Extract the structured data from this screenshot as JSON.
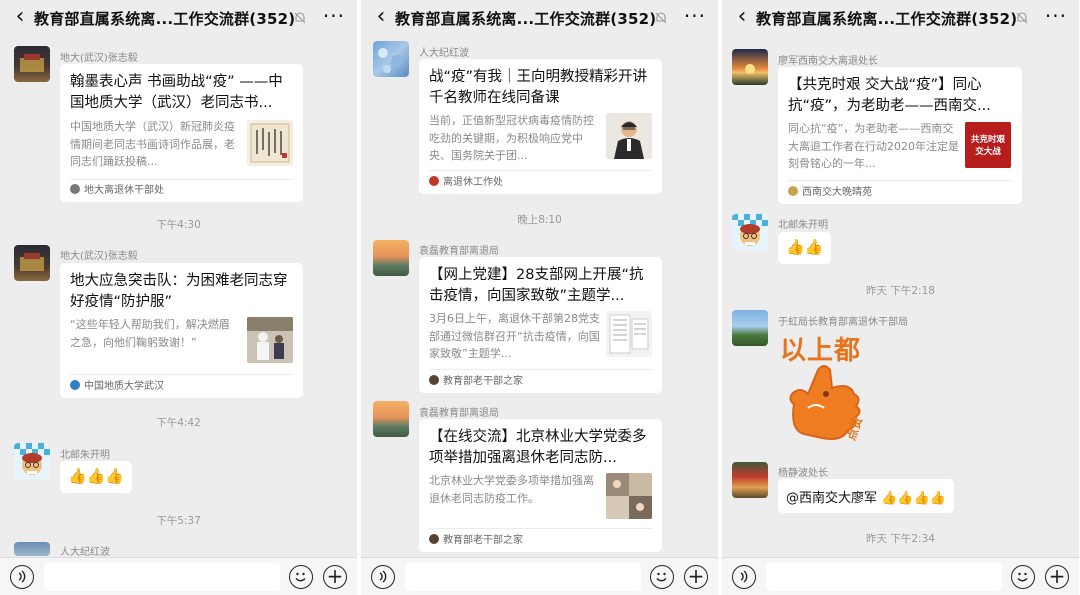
{
  "header": {
    "title": "教育部直属系统离...工作交流群(352)"
  },
  "panels": [
    {
      "messages": [
        {
          "sender": "地大(武汉)张志毅",
          "title": "翰墨表心声 书画助战“疫” ——中国地质大学（武汉）老同志书...",
          "desc": "中国地质大学（武汉）新冠肺炎疫情期间老同志书画诗词作品展，老同志们踊跃投稿...",
          "source": "地大离退休干部处"
        },
        {
          "time": "下午4:30"
        },
        {
          "sender": "地大(武汉)张志毅",
          "title": "地大应急突击队：为困难老同志穿好疫情“防护服”",
          "desc": "“这些年轻人帮助我们，解决燃眉之急，向他们鞠躬致谢！”",
          "source": "中国地质大学武汉"
        },
        {
          "time": "下午4:42"
        },
        {
          "sender": "北邮朱开明",
          "text": "👍👍👍"
        },
        {
          "time": "下午5:37"
        },
        {
          "sender": "人大纪红波"
        }
      ]
    },
    {
      "messages": [
        {
          "sender": "人大纪红波",
          "title": "战“疫”有我｜王向明教授精彩开讲千名教师在线同备课",
          "desc": "当前，正值新型冠状病毒疫情防控吃劲的关键期，为积极响应党中央、国务院关于团...",
          "source": "离退休工作处"
        },
        {
          "time": "晚上8:10"
        },
        {
          "sender": "袁磊教育部离退局",
          "title": "【网上党建】28支部网上开展“抗击疫情，向国家致敬”主题学...",
          "desc": "3月6日上午，离退休干部第28党支部通过微信群召开“抗击疫情，向国家致敬”主题学...",
          "source": "教育部老干部之家"
        },
        {
          "sender": "袁磊教育部离退局",
          "title": "【在线交流】北京林业大学党委多项举措加强离退休老同志防...",
          "desc": "北京林业大学党委多项举措加强离退休老同志防疫工作。",
          "source": "教育部老干部之家"
        }
      ]
    },
    {
      "messages": [
        {
          "sender": "廖军西南交大离退处长",
          "title": "【共克时艰 交大战“疫”】同心抗“疫”，为老助老——西南交...",
          "desc": "同心抗“疫”，为老助老——西南交大离退工作者在行动2020年注定是刻骨铭心的一年...",
          "source": "西南交大晚晴苑",
          "thumb_text": "共克时艰 交大战"
        },
        {
          "sender": "北邮朱开明",
          "text": "👍👍"
        },
        {
          "time": "昨天 下午2:18"
        },
        {
          "sender": "于虹局长教育部离退休干部局",
          "sticker_text": "以上都",
          "sticker_sub": "点赞"
        },
        {
          "sender": "杨静波处长",
          "text": "@西南交大廖军 👍👍👍👍"
        },
        {
          "time": "昨天 下午2:34"
        }
      ]
    }
  ],
  "icons": {
    "back": "back-arrow-icon",
    "mute": "mute-bell-icon",
    "more": "more-dots-icon",
    "voice": "voice-icon",
    "emoji": "emoji-icon",
    "plus": "plus-icon"
  },
  "colors": {
    "background": "#ededed",
    "card": "#ffffff",
    "thumbs": "#e8a31c",
    "sticker": "#e8731c"
  }
}
